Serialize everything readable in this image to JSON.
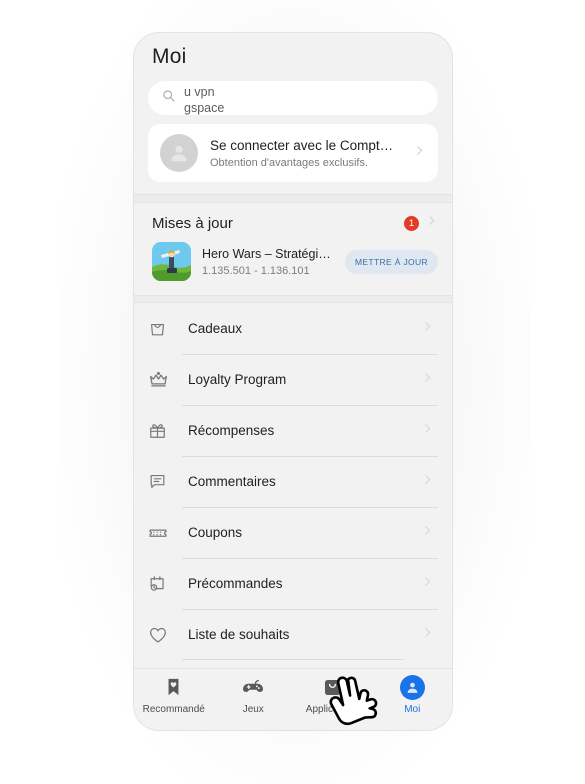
{
  "header": {
    "title": "Moi"
  },
  "search": {
    "icon": "search-icon",
    "line1": "u vpn",
    "line2": "gspace"
  },
  "account": {
    "avatar_icon": "person-placeholder-icon",
    "title": "Se connecter avec le Compt…",
    "subtitle": "Obtention d'avantages exclusifs.",
    "chevron_icon": "chevron-right-icon"
  },
  "updates": {
    "title": "Mises à jour",
    "badge_count": "1",
    "badge_color": "#e53a26",
    "chevron_icon": "chevron-right-icon",
    "app": {
      "icon": "hero-wars-app-icon",
      "name": "Hero Wars – Stratégie RPG",
      "version": "1.135.501 - 1.136.101",
      "button_label": "METTRE À JOUR",
      "button_color": "#3c6ea5"
    }
  },
  "menu": {
    "items": [
      {
        "icon": "shopping-bag-icon",
        "label": "Cadeaux"
      },
      {
        "icon": "crown-icon",
        "label": "Loyalty Program"
      },
      {
        "icon": "gift-box-icon",
        "label": "Récompenses"
      },
      {
        "icon": "comment-bubble-icon",
        "label": "Commentaires"
      },
      {
        "icon": "ticket-icon",
        "label": "Coupons"
      },
      {
        "icon": "calendar-clock-icon",
        "label": "Précommandes"
      },
      {
        "icon": "heart-icon",
        "label": "Liste de souhaits"
      }
    ],
    "chevron_icon": "chevron-right-icon"
  },
  "tabbar": {
    "active_color": "#1a73e8",
    "tabs": [
      {
        "icon": "bookmark-heart-icon",
        "label": "Recommandé",
        "active": false
      },
      {
        "icon": "gamepad-icon",
        "label": "Jeux",
        "active": false
      },
      {
        "icon": "apps-bag-icon",
        "label": "Applications",
        "active": false
      },
      {
        "icon": "person-avatar-icon",
        "label": "Moi",
        "active": true
      }
    ]
  },
  "cursor": {
    "icon": "pointing-hand-cursor"
  }
}
